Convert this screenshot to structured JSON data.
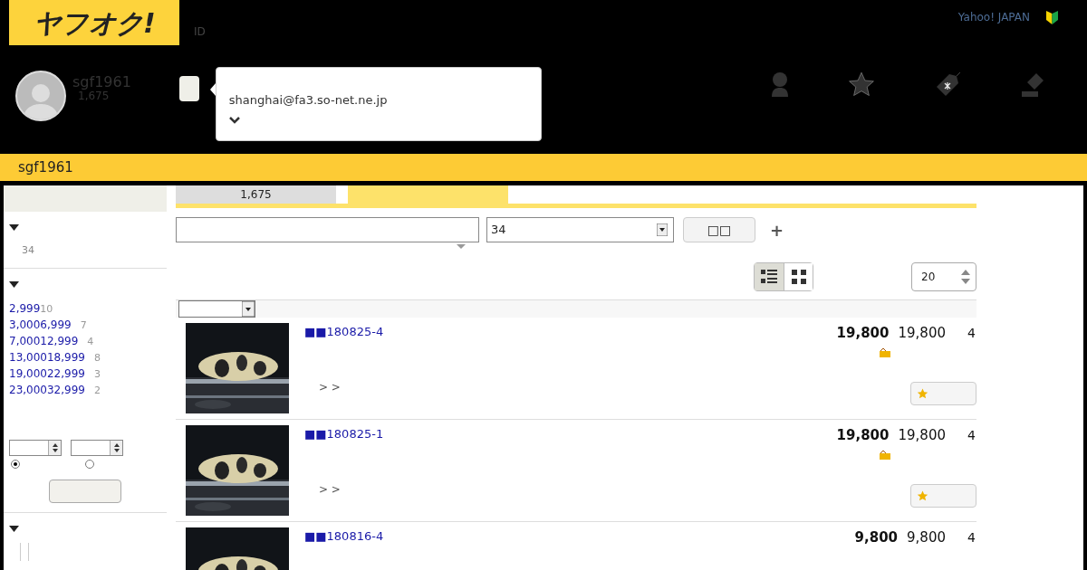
{
  "header": {
    "logo": "ヤフオク!",
    "id_label": "ID",
    "yahoo_link": "Yahoo! JAPAN",
    "user": {
      "name": "sgf1961",
      "points": "1,675"
    },
    "popover": {
      "email": "shanghai@fa3.so-net.ne.jp",
      "expanded": false
    }
  },
  "title_bar": "sgf1961",
  "sidebar": {
    "sections": [
      {
        "kind": "count",
        "expanded": true,
        "count": "34"
      },
      {
        "kind": "prices",
        "expanded": true,
        "items": [
          {
            "label": "2,999",
            "count": "10"
          },
          {
            "label": "3,0006,999",
            "count": "7"
          },
          {
            "label": "7,00012,999",
            "count": "4"
          },
          {
            "label": "13,00018,999",
            "count": "8"
          },
          {
            "label": "19,00022,999",
            "count": "3"
          },
          {
            "label": "23,00032,999",
            "count": "2"
          }
        ],
        "radios": [
          {
            "selected": true
          },
          {
            "selected": false
          }
        ]
      },
      {
        "kind": "empty",
        "expanded": true
      }
    ]
  },
  "tabs": [
    {
      "label": "1,675",
      "selected": false
    },
    {
      "selected": true
    }
  ],
  "search": {
    "category": "34",
    "button": "□□",
    "plus": "+"
  },
  "view_toggle": [
    {
      "kind": "list",
      "selected": true
    },
    {
      "kind": "grid",
      "selected": false
    }
  ],
  "per_page": "20",
  "items": [
    {
      "title": "■■180825-4",
      "breadcrumb": "> >",
      "price": "19,800",
      "buy_now": "19,800",
      "bids": "4"
    },
    {
      "title": "■■180825-1",
      "breadcrumb": "> >",
      "price": "19,800",
      "buy_now": "19,800",
      "bids": "4"
    },
    {
      "title": "■■180816-4",
      "price": "9,800",
      "buy_now": "9,800",
      "bids": "4"
    }
  ]
}
